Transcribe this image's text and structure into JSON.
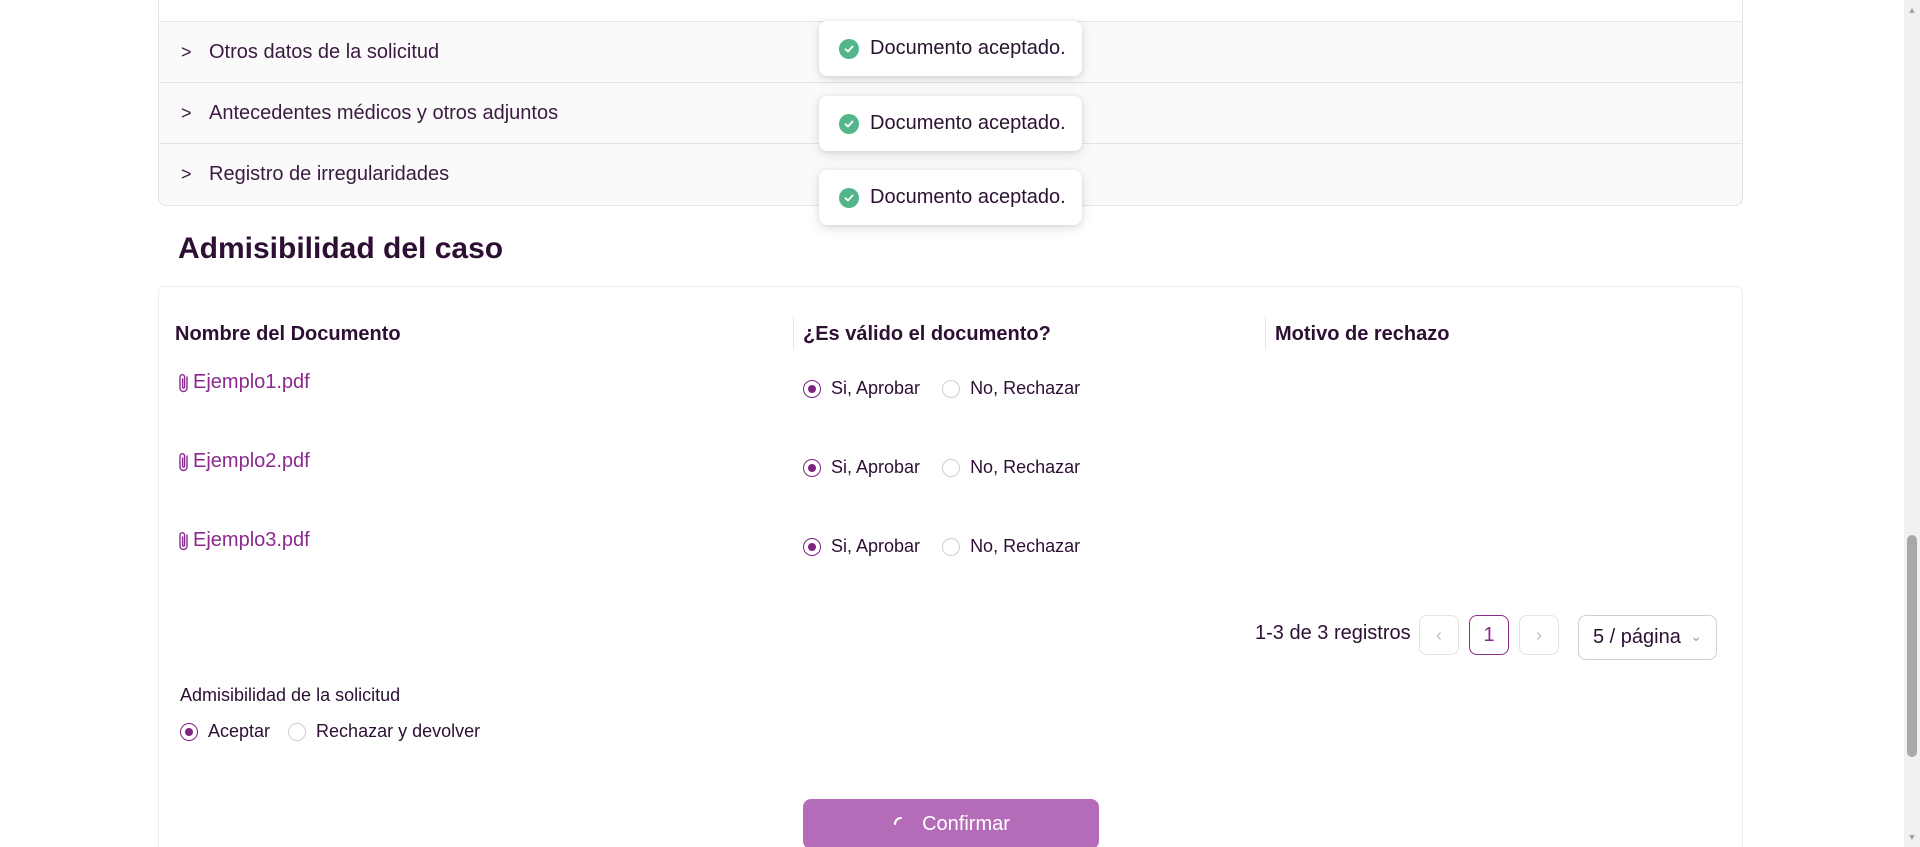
{
  "accordion": {
    "items": [
      {
        "label": "Otros datos de la solicitud"
      },
      {
        "label": "Antecedentes médicos y otros adjuntos"
      },
      {
        "label": "Registro de irregularidades"
      }
    ]
  },
  "toasts": [
    {
      "message": "Documento aceptado."
    },
    {
      "message": "Documento aceptado."
    },
    {
      "message": "Documento aceptado."
    }
  ],
  "section": {
    "title": "Admisibilidad del caso"
  },
  "table": {
    "columns": [
      "Nombre del Documento",
      "¿Es válido el documento?",
      "Motivo de rechazo"
    ],
    "rows": [
      {
        "document": "Ejemplo1.pdf",
        "approve_label": "Si, Aprobar",
        "reject_label": "No, Rechazar",
        "selected": "approve"
      },
      {
        "document": "Ejemplo2.pdf",
        "approve_label": "Si, Aprobar",
        "reject_label": "No, Rechazar",
        "selected": "approve"
      },
      {
        "document": "Ejemplo3.pdf",
        "approve_label": "Si, Aprobar",
        "reject_label": "No, Rechazar",
        "selected": "approve"
      }
    ]
  },
  "pagination": {
    "total_text": "1-3 de 3 registros",
    "current_page": "1",
    "page_size": "5 / página"
  },
  "admissibility": {
    "label": "Admisibilidad de la solicitud",
    "accept_label": "Aceptar",
    "reject_label": "Rechazar y devolver",
    "selected": "accept"
  },
  "confirm": {
    "label": "Confirmar"
  },
  "colors": {
    "accent": "#8b2a8e",
    "confirm_bg": "#b46cb8",
    "success": "#52b68a",
    "heading": "#2d0f33"
  }
}
